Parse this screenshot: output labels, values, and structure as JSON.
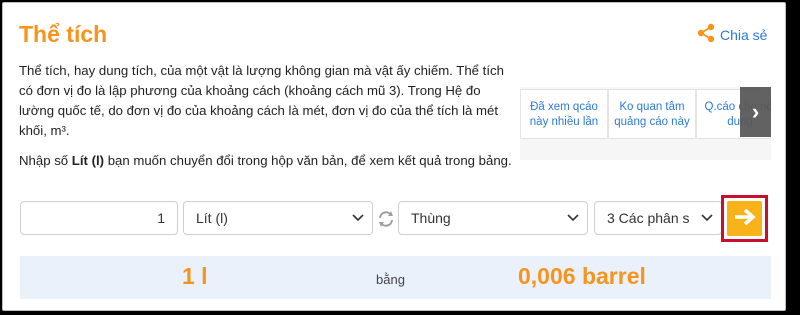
{
  "page": {
    "title": "Thể tích",
    "share_label": "Chia sẻ",
    "description": "Thể tích, hay dung tích, của một vật là lượng không gian mà vật ấy chiếm. Thể tích có đơn vị đo là lập phương của khoảng cách (khoảng cách mũ 3). Trong Hệ đo lường quốc tế, do đơn vị đo của khoảng cách là mét, đơn vị đo của thể tích là mét khối, m³.",
    "hint_prefix": "Nhập số ",
    "hint_bold": "Lít (l)",
    "hint_suffix": " bạn muốn chuyển đổi trong hộp văn bản, để xem kết quả trong bảng."
  },
  "ads": {
    "items": [
      {
        "label": "Đã xem qcáo này nhiều lần"
      },
      {
        "label": "Ko quan tâm quảng cáo này"
      },
      {
        "label": "Q.cáo che nội dung"
      }
    ],
    "next_glyph": "›"
  },
  "converter": {
    "input_value": "1",
    "from_unit": "Lít (l)",
    "to_unit": "Thùng",
    "precision": "3 Các phân s",
    "swap_icon": "swap-icon",
    "go_icon": "arrow-right-icon"
  },
  "result": {
    "left": "1 l",
    "middle": "bằng",
    "right": "0,006 barrel"
  },
  "colors": {
    "accent": "#f7941d",
    "link": "#2b7bd6",
    "go_button": "#f9b31a",
    "highlight_border": "#c8102e",
    "result_bg": "#eaf1fb"
  }
}
